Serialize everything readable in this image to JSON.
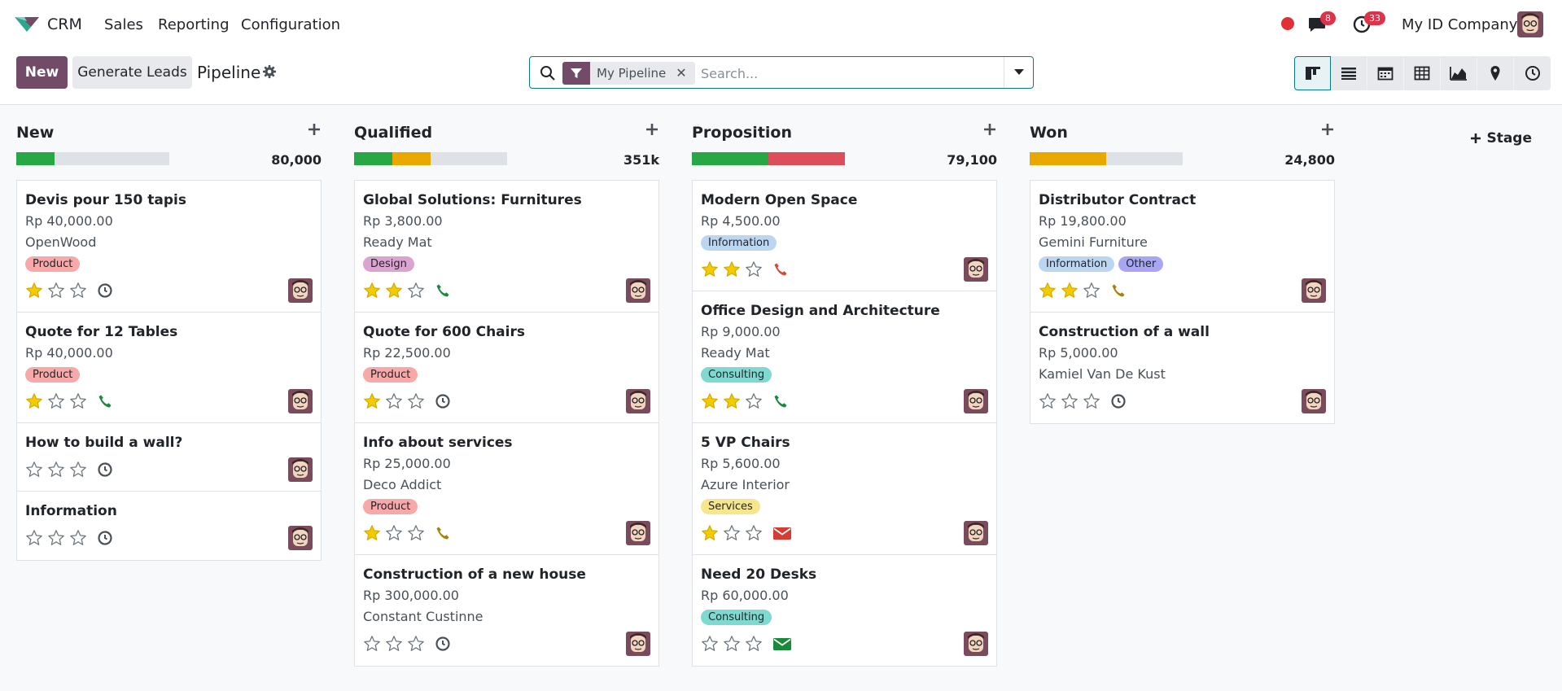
{
  "navbar": {
    "app_name": "CRM",
    "menu": [
      "Sales",
      "Reporting",
      "Configuration"
    ],
    "messages_count": "8",
    "activities_count": "33",
    "company": "My ID Company"
  },
  "control": {
    "new_label": "New",
    "generate_label": "Generate Leads",
    "title": "Pipeline",
    "facet_label": "My Pipeline",
    "facet_remove": "✕",
    "search_placeholder": "Search..."
  },
  "views": [
    "kanban-view-icon",
    "list-view-icon",
    "calendar-view-icon",
    "pivot-view-icon",
    "graph-view-icon",
    "map-view-icon",
    "activity-view-icon"
  ],
  "add_stage_label": "Stage",
  "colors": {
    "brand": "#714b67",
    "teal": "#017e84",
    "star_on": "#f3cc00",
    "progress_green": "#28a745",
    "progress_orange": "#e9a800",
    "progress_red": "#dc4e5a",
    "progress_gray": "#dee2e6"
  },
  "columns": [
    {
      "title": "New",
      "total": "80,000",
      "progress": [
        {
          "color": "#28a745",
          "fraction": 0.25
        },
        {
          "color": "#dee2e6",
          "fraction": 0.75
        }
      ],
      "cards": [
        {
          "title": "Devis pour 150 tapis",
          "amount": "Rp 40,000.00",
          "customer": "OpenWood",
          "tags": [
            {
              "label": "Product",
              "color": "#f7a8a8"
            }
          ],
          "stars": 1,
          "activity": "clock"
        },
        {
          "title": "Quote for 12 Tables",
          "amount": "Rp 40,000.00",
          "customer": "",
          "tags": [
            {
              "label": "Product",
              "color": "#f7a8a8"
            }
          ],
          "stars": 1,
          "activity": "phone-green"
        },
        {
          "title": "How to build a wall?",
          "amount": "",
          "customer": "",
          "tags": [],
          "stars": 0,
          "activity": "clock"
        },
        {
          "title": "Information",
          "amount": "",
          "customer": "",
          "tags": [],
          "stars": 0,
          "activity": "clock"
        }
      ]
    },
    {
      "title": "Qualified",
      "total": "351k",
      "progress": [
        {
          "color": "#28a745",
          "fraction": 0.25
        },
        {
          "color": "#e9a800",
          "fraction": 0.25
        },
        {
          "color": "#dee2e6",
          "fraction": 0.5
        }
      ],
      "cards": [
        {
          "title": "Global Solutions: Furnitures",
          "amount": "Rp 3,800.00",
          "customer": "Ready Mat",
          "tags": [
            {
              "label": "Design",
              "color": "#dba4d0"
            }
          ],
          "stars": 2,
          "activity": "phone-green"
        },
        {
          "title": "Quote for 600 Chairs",
          "amount": "Rp 22,500.00",
          "customer": "",
          "tags": [
            {
              "label": "Product",
              "color": "#f7a8a8"
            }
          ],
          "stars": 1,
          "activity": "clock"
        },
        {
          "title": "Info about services",
          "amount": "Rp 25,000.00",
          "customer": "Deco Addict",
          "tags": [
            {
              "label": "Product",
              "color": "#f7a8a8"
            }
          ],
          "stars": 1,
          "activity": "phone-yellow"
        },
        {
          "title": "Construction of a new house",
          "amount": "Rp 300,000.00",
          "customer": "Constant Custinne",
          "tags": [],
          "stars": 0,
          "activity": "clock"
        }
      ]
    },
    {
      "title": "Proposition",
      "total": "79,100",
      "progress": [
        {
          "color": "#28a745",
          "fraction": 0.5
        },
        {
          "color": "#dc4e5a",
          "fraction": 0.5
        }
      ],
      "cards": [
        {
          "title": "Modern Open Space",
          "amount": "Rp 4,500.00",
          "customer": "",
          "tags": [
            {
              "label": "Information",
              "color": "#bcd6f2"
            }
          ],
          "stars": 2,
          "activity": "phone-red"
        },
        {
          "title": "Office Design and Architecture",
          "amount": "Rp 9,000.00",
          "customer": "Ready Mat",
          "tags": [
            {
              "label": "Consulting",
              "color": "#7ed9d0"
            }
          ],
          "stars": 2,
          "activity": "phone-green"
        },
        {
          "title": "5 VP Chairs",
          "amount": "Rp 5,600.00",
          "customer": "Azure Interior",
          "tags": [
            {
              "label": "Services",
              "color": "#f6e68c"
            }
          ],
          "stars": 1,
          "activity": "mail-red"
        },
        {
          "title": "Need 20 Desks",
          "amount": "Rp 60,000.00",
          "customer": "",
          "tags": [
            {
              "label": "Consulting",
              "color": "#7ed9d0"
            }
          ],
          "stars": 0,
          "activity": "mail-green"
        }
      ]
    },
    {
      "title": "Won",
      "total": "24,800",
      "progress": [
        {
          "color": "#e9a800",
          "fraction": 0.5
        },
        {
          "color": "#dee2e6",
          "fraction": 0.5
        }
      ],
      "cards": [
        {
          "title": "Distributor Contract",
          "amount": "Rp 19,800.00",
          "customer": "Gemini Furniture",
          "tags": [
            {
              "label": "Information",
              "color": "#bcd6f2"
            },
            {
              "label": "Other",
              "color": "#a8a6f2"
            }
          ],
          "stars": 2,
          "activity": "phone-yellow"
        },
        {
          "title": "Construction of a wall",
          "amount": "Rp 5,000.00",
          "customer": "Kamiel Van De Kust",
          "tags": [],
          "stars": 0,
          "activity": "clock"
        }
      ]
    }
  ]
}
